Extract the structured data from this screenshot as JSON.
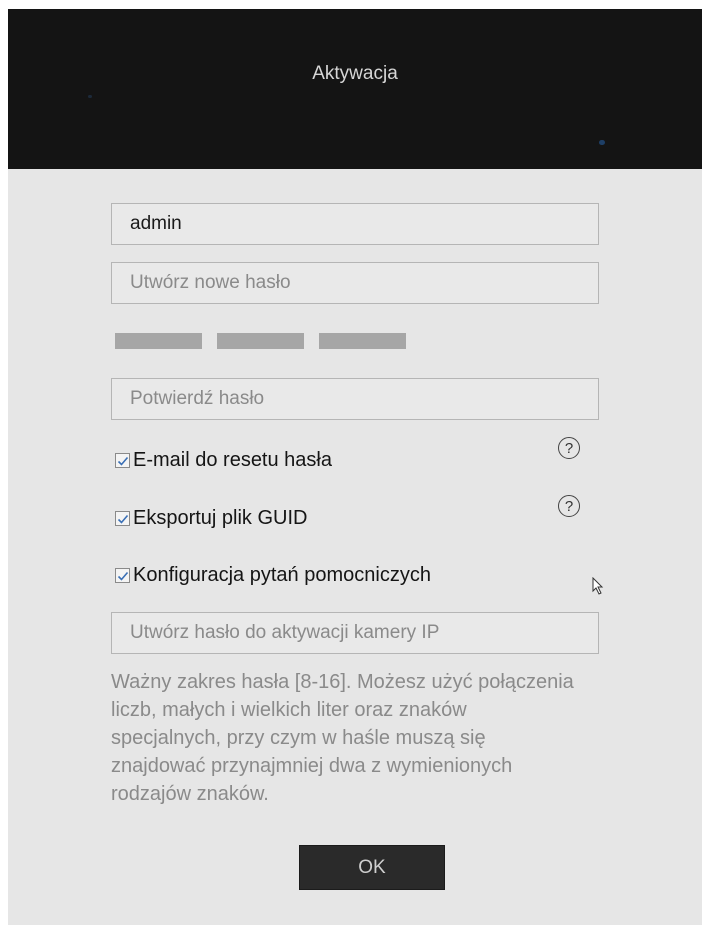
{
  "dialog": {
    "title": "Aktywacja"
  },
  "form": {
    "username_value": "admin",
    "new_password_placeholder": "Utwórz nowe hasło",
    "confirm_password_placeholder": "Potwierdź hasło",
    "camera_password_placeholder": "Utwórz hasło do aktywacji kamery IP"
  },
  "options": [
    {
      "label": "E-mail do resetu hasła",
      "checked": true,
      "help_icon": "question-circle-icon"
    },
    {
      "label": "Eksportuj plik GUID",
      "checked": true,
      "help_icon": "question-circle-icon"
    },
    {
      "label": "Konfiguracja pytań pomocniczych",
      "checked": true
    }
  ],
  "hint": "Ważny zakres hasła [8-16]. Możesz użyć połączenia liczb, małych i wielkich liter oraz znaków specjalnych, przy czym w haśle muszą się znajdować przynajmniej dwa z wymienionych rodzajów znaków.",
  "ok_label": "OK",
  "colors": {
    "titlebar": "#141414",
    "panel": "#e6e6e6",
    "check_accent": "#3a6fb5",
    "button": "#2a2a2a"
  }
}
